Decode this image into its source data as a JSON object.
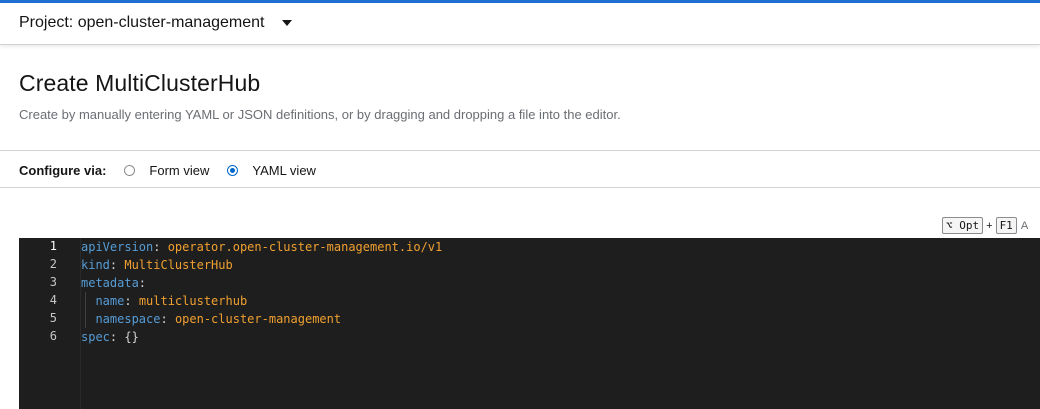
{
  "project": {
    "label": "Project: open-cluster-management"
  },
  "page": {
    "title": "Create MultiClusterHub",
    "description": "Create by manually entering YAML or JSON definitions, or by dragging and dropping a file into the editor."
  },
  "configure": {
    "label": "Configure via:",
    "options": [
      {
        "label": "Form view",
        "checked": false
      },
      {
        "label": "YAML view",
        "checked": true
      }
    ]
  },
  "shortcut": {
    "modifier": "⌥ Opt",
    "plus": "+",
    "key": "F1",
    "cut_text": "A"
  },
  "editor": {
    "lines": [
      {
        "num": "1",
        "key": "apiVersion",
        "sep": ": ",
        "value": "operator.open-cluster-management.io/v1"
      },
      {
        "num": "2",
        "key": "kind",
        "sep": ": ",
        "value": "MultiClusterHub"
      },
      {
        "num": "3",
        "key": "metadata",
        "sep": ":",
        "value": ""
      },
      {
        "num": "4",
        "key": "  name",
        "sep": ": ",
        "value": "multiclusterhub"
      },
      {
        "num": "5",
        "key": "  namespace",
        "sep": ": ",
        "value": "open-cluster-management"
      },
      {
        "num": "6",
        "key": "spec",
        "sep": ": ",
        "value": "{}"
      }
    ]
  },
  "colors": {
    "accent": "#0066cc",
    "editor_bg": "#1e1e1e",
    "yaml_key": "#569cd6",
    "yaml_value": "#f0a030"
  }
}
